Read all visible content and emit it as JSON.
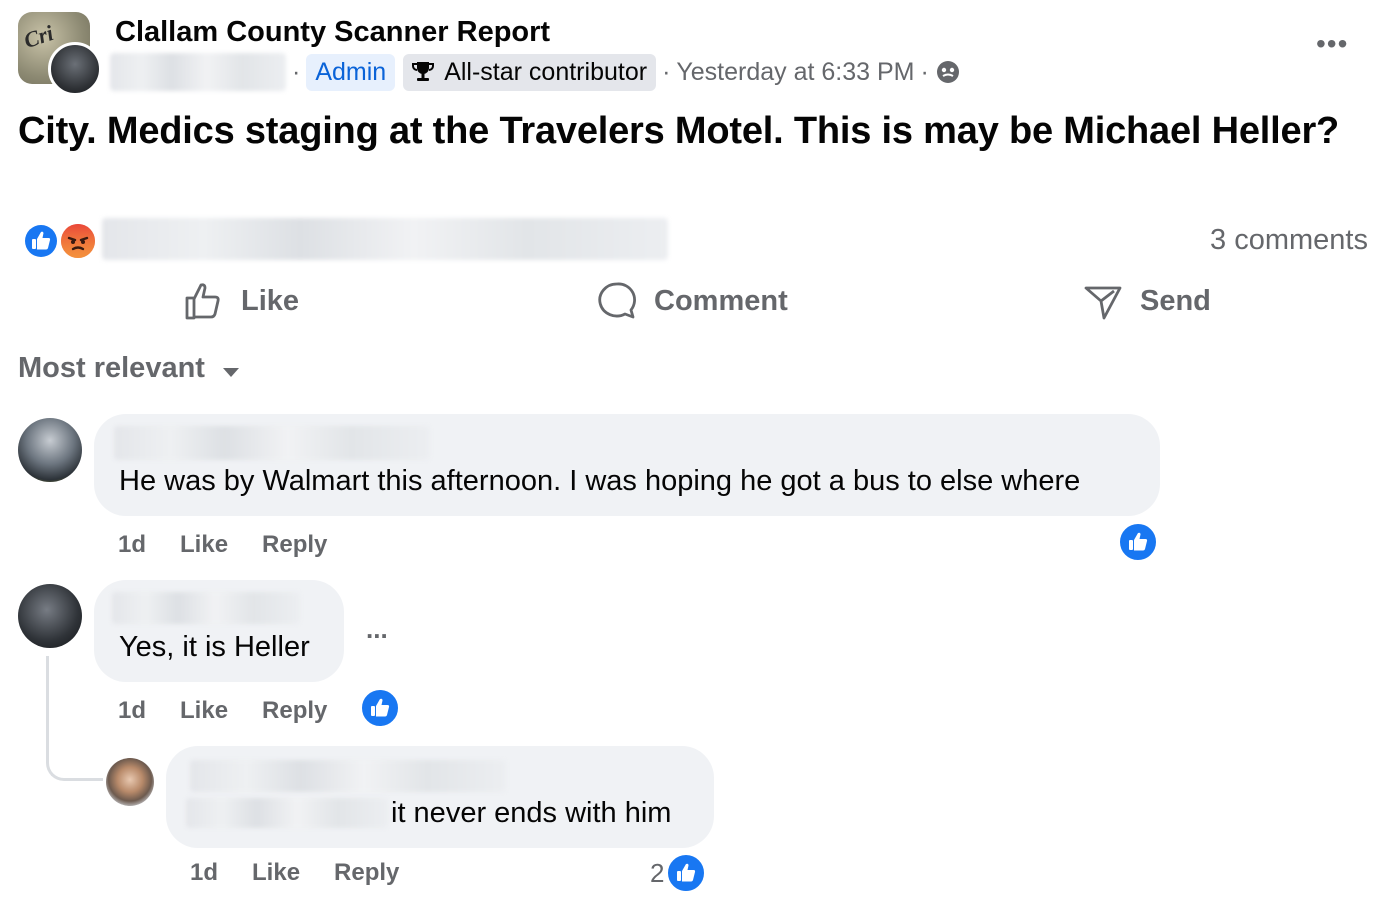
{
  "post": {
    "group_name": "Clallam County Scanner Report",
    "group_avatar_text": "Cri",
    "badge_admin": "Admin",
    "badge_allstar": "All-star contributor",
    "timestamp": "Yesterday at 6:33 PM",
    "privacy_icon": "globe-icon",
    "more_icon": "more-horizontal-icon",
    "text": "City. Medics staging at the Travelers Motel. This is may be Michael Heller?"
  },
  "reactions": {
    "icons": [
      "like-reaction-icon",
      "angry-reaction-icon"
    ],
    "comments_count": "3 comments"
  },
  "actions": {
    "like": "Like",
    "comment": "Comment",
    "send": "Send"
  },
  "sort": {
    "label": "Most relevant",
    "icon": "caret-down-icon"
  },
  "comments": [
    {
      "text": "He was by Walmart this afternoon. I was hoping he got a bus to else where",
      "time": "1d",
      "like": "Like",
      "reply": "Reply",
      "reaction_count": ""
    },
    {
      "text": "Yes, it is Heller",
      "time": "1d",
      "like": "Like",
      "reply": "Reply",
      "reaction_count": "",
      "more": "..."
    },
    {
      "text": "it never ends with him",
      "time": "1d",
      "like": "Like",
      "reply": "Reply",
      "reaction_count": "2"
    }
  ],
  "colors": {
    "accent_blue": "#1877f2",
    "secondary_text": "#65676b",
    "bubble_bg": "#f0f2f5",
    "angry_orange": "#f0553a"
  }
}
